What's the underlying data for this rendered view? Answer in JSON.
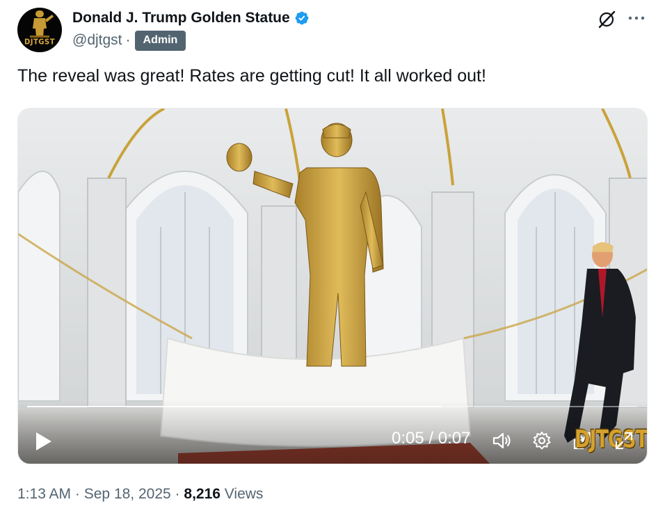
{
  "author": {
    "display_name": "Donald J. Trump Golden Statue",
    "handle": "@djtgst",
    "separator": "·",
    "badge": "Admin",
    "avatar_text": "DJTGST",
    "verified_icon": "verified-badge-icon",
    "verified_color": "#1d9bf0"
  },
  "header_icons": [
    "grok-icon",
    "more-icon"
  ],
  "tweet": {
    "text": "The reveal was great! Rates are getting cut! It all worked out!"
  },
  "video": {
    "current_time": "0:05",
    "duration": "0:07",
    "time_display": "0:05 / 0:07",
    "progress": 0.68,
    "watermark": "DJTGST",
    "controls": [
      "play-icon",
      "volume-icon",
      "settings-icon",
      "pip-icon",
      "fullscreen-icon"
    ]
  },
  "meta": {
    "time": "1:13 AM",
    "date": "Sep 18, 2025",
    "sep1": "·",
    "sep2": "·",
    "views_count": "8,216",
    "views_label": "Views"
  },
  "colors": {
    "text_primary": "#0f1419",
    "text_secondary": "#536471",
    "badge_bg": "#536471",
    "gold": "#c9a23a"
  }
}
